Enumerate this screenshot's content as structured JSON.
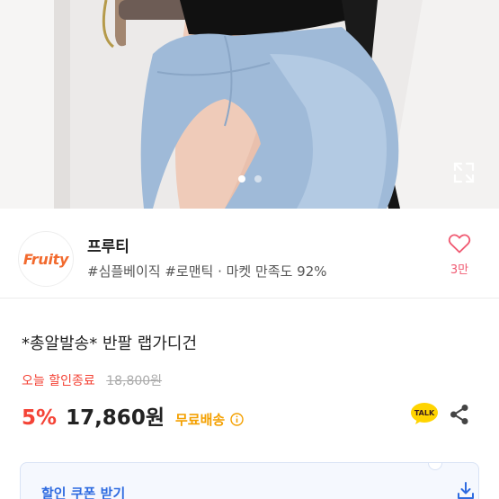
{
  "gallery": {
    "image_count": 2,
    "active_index": 0,
    "expand_icon": "expand-icon"
  },
  "seller": {
    "logo_text": "Fruity",
    "name": "프루티",
    "tags": "#심플베이직 #로맨틱 · 마켓 만족도 92%",
    "like_icon": "heart-outline-icon",
    "like_count": "3만"
  },
  "product": {
    "title": "*총알발송* 반팔 랩가디건",
    "sale_label": "오늘 할인종료",
    "original_price": "18,800원",
    "discount": "5%",
    "price": "17,860원",
    "shipping": "무료배송"
  },
  "actions": {
    "talk_label": "TALK",
    "share_icon": "share-icon"
  },
  "coupon": {
    "label": "할인 쿠폰 받기",
    "icon": "download-icon"
  },
  "colors": {
    "accent_red": "#f44336",
    "brand_orange": "#f26a2e",
    "shipping_yellow": "#f4a000",
    "coupon_blue": "#2f6be0",
    "like_pink": "#f05a72",
    "kakao_yellow": "#ffd400"
  }
}
